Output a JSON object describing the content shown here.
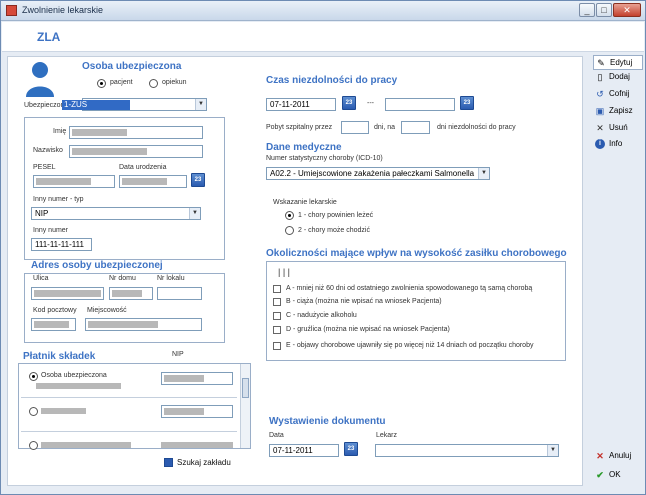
{
  "window": {
    "title": "Zwolnienie lekarskie"
  },
  "header": {
    "label": "ZLA"
  },
  "insured": {
    "title": "Osoba ubezpieczona",
    "radio_patient": "pacjent",
    "radio_guardian": "opiekun",
    "insured_in_label": "Ubezpieczony w:",
    "insured_in_value": "1-ZUS",
    "first_name_label": "Imię",
    "last_name_label": "Nazwisko",
    "pesel_label": "PESEL",
    "birth_date_label": "Data urodzenia",
    "other_number_type_label": "Inny numer - typ",
    "other_number_type_value": "NIP",
    "other_number_label": "Inny numer",
    "other_number_value": "111-11-11-111"
  },
  "address": {
    "title": "Adres osoby ubezpieczonej",
    "street_label": "Ulica",
    "house_label": "Nr domu",
    "flat_label": "Nr lokalu",
    "postal_label": "Kod pocztowy",
    "city_label": "Miejscowość"
  },
  "payer": {
    "title": "Płatnik składek",
    "nip_label": "NIP",
    "option_insured": "Osoba ubezpieczona",
    "search_button": "Szukaj zakładu"
  },
  "incapacity": {
    "title": "Czas niezdolności do pracy",
    "date_from": "07-11-2011",
    "separator": "---",
    "hospital_label": "Pobyt szpitalny przez",
    "days_on_label": "dni, na",
    "days_incapacity_label": "dni niezdolności do pracy"
  },
  "medical": {
    "title": "Dane medyczne",
    "icd_label": "Numer statystyczny choroby (ICD-10)",
    "icd_value": "A02.2 - Umiejscowione zakażenia pałeczkami Salmonella",
    "indication_label": "Wskazanie lekarskie",
    "option1": "1 - chory powinien leżeć",
    "option2": "2 - chory może chodzić"
  },
  "circumstances": {
    "title": "Okoliczności mające wpływ na wysokość zasiłku chorobowego",
    "marks": "| | |",
    "items": [
      "A - mniej niż 60 dni od ostatniego zwolnienia spowodowanego tą samą chorobą",
      "B - ciąża (można nie wpisać na wniosek Pacjenta)",
      "C - nadużycie alkoholu",
      "D - gruźlica (można nie wpisać na wniosek Pacjenta)",
      "E - objawy chorobowe ujawniły się po więcej niż 14 dniach od początku choroby"
    ]
  },
  "issue": {
    "title": "Wystawienie dokumentu",
    "date_label": "Data",
    "date_value": "07-11-2011",
    "doctor_label": "Lekarz"
  },
  "calendar_icon": "23",
  "sidebar": {
    "edit": "Edytuj",
    "add": "Dodaj",
    "undo": "Cofnij",
    "save": "Zapisz",
    "delete": "Usuń",
    "info": "Info",
    "cancel": "Anuluj",
    "ok": "OK"
  }
}
